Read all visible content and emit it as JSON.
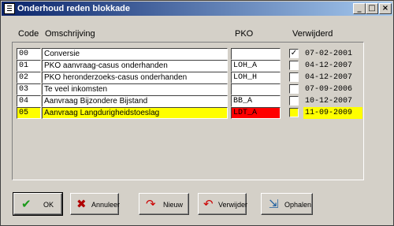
{
  "window": {
    "title": "Onderhoud reden blokkade",
    "min_glyph": "_",
    "max_glyph": "□",
    "close_glyph": "×"
  },
  "headers": {
    "code": "Code",
    "omschrijving": "Omschrijving",
    "pko": "PKO",
    "verwijderd": "Verwijderd"
  },
  "rows": [
    {
      "code": "00",
      "omschrijving": "Conversie",
      "pko": "",
      "verwijderd": "✓",
      "datum": "07-02-2001"
    },
    {
      "code": "01",
      "omschrijving": "PKO aanvraag-casus onderhanden",
      "pko": "LOH_A",
      "verwijderd": "",
      "datum": "04-12-2007"
    },
    {
      "code": "02",
      "omschrijving": "PKO heronderzoeks-casus onderhanden",
      "pko": "LOH_H",
      "verwijderd": "",
      "datum": "04-12-2007"
    },
    {
      "code": "03",
      "omschrijving": "Te veel inkomsten",
      "pko": "",
      "verwijderd": "",
      "datum": "07-09-2006"
    },
    {
      "code": "04",
      "omschrijving": "Aanvraag Bijzondere Bijstand",
      "pko": "BB_A",
      "verwijderd": "",
      "datum": "10-12-2007"
    },
    {
      "code": "05",
      "omschrijving": "Aanvraag Langdurigheidstoeslag",
      "pko": "LDT_A",
      "verwijderd": "",
      "datum": "11-09-2009"
    }
  ],
  "buttons": {
    "ok": "OK",
    "annuleer": "Annuleer",
    "nieuw": "Nieuw",
    "verwijder": "Verwijder",
    "ophalen": "Ophalen"
  },
  "icons": {
    "ok": "checkmark-icon",
    "annuleer": "cross-icon",
    "nieuw": "new-arrow-icon",
    "verwijder": "undo-arrow-icon",
    "ophalen": "fetch-icon"
  },
  "colors": {
    "selected_row": "#ffff00",
    "pko_highlight": "#ff0000",
    "ok_icon": "#1a9a1a",
    "cancel_icon": "#b00000",
    "arrow_icon": "#cc0000",
    "title_bar": "#0a246a"
  }
}
